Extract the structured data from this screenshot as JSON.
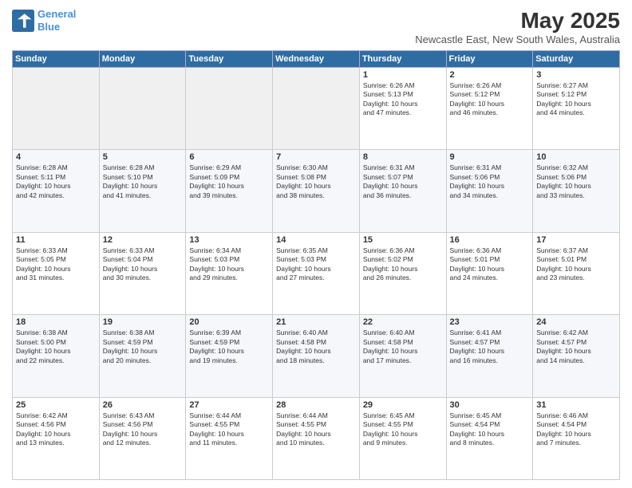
{
  "header": {
    "logo_line1": "General",
    "logo_line2": "Blue",
    "month": "May 2025",
    "location": "Newcastle East, New South Wales, Australia"
  },
  "weekdays": [
    "Sunday",
    "Monday",
    "Tuesday",
    "Wednesday",
    "Thursday",
    "Friday",
    "Saturday"
  ],
  "weeks": [
    [
      {
        "day": "",
        "info": ""
      },
      {
        "day": "",
        "info": ""
      },
      {
        "day": "",
        "info": ""
      },
      {
        "day": "",
        "info": ""
      },
      {
        "day": "1",
        "info": "Sunrise: 6:26 AM\nSunset: 5:13 PM\nDaylight: 10 hours\nand 47 minutes."
      },
      {
        "day": "2",
        "info": "Sunrise: 6:26 AM\nSunset: 5:12 PM\nDaylight: 10 hours\nand 46 minutes."
      },
      {
        "day": "3",
        "info": "Sunrise: 6:27 AM\nSunset: 5:12 PM\nDaylight: 10 hours\nand 44 minutes."
      }
    ],
    [
      {
        "day": "4",
        "info": "Sunrise: 6:28 AM\nSunset: 5:11 PM\nDaylight: 10 hours\nand 42 minutes."
      },
      {
        "day": "5",
        "info": "Sunrise: 6:28 AM\nSunset: 5:10 PM\nDaylight: 10 hours\nand 41 minutes."
      },
      {
        "day": "6",
        "info": "Sunrise: 6:29 AM\nSunset: 5:09 PM\nDaylight: 10 hours\nand 39 minutes."
      },
      {
        "day": "7",
        "info": "Sunrise: 6:30 AM\nSunset: 5:08 PM\nDaylight: 10 hours\nand 38 minutes."
      },
      {
        "day": "8",
        "info": "Sunrise: 6:31 AM\nSunset: 5:07 PM\nDaylight: 10 hours\nand 36 minutes."
      },
      {
        "day": "9",
        "info": "Sunrise: 6:31 AM\nSunset: 5:06 PM\nDaylight: 10 hours\nand 34 minutes."
      },
      {
        "day": "10",
        "info": "Sunrise: 6:32 AM\nSunset: 5:06 PM\nDaylight: 10 hours\nand 33 minutes."
      }
    ],
    [
      {
        "day": "11",
        "info": "Sunrise: 6:33 AM\nSunset: 5:05 PM\nDaylight: 10 hours\nand 31 minutes."
      },
      {
        "day": "12",
        "info": "Sunrise: 6:33 AM\nSunset: 5:04 PM\nDaylight: 10 hours\nand 30 minutes."
      },
      {
        "day": "13",
        "info": "Sunrise: 6:34 AM\nSunset: 5:03 PM\nDaylight: 10 hours\nand 29 minutes."
      },
      {
        "day": "14",
        "info": "Sunrise: 6:35 AM\nSunset: 5:03 PM\nDaylight: 10 hours\nand 27 minutes."
      },
      {
        "day": "15",
        "info": "Sunrise: 6:36 AM\nSunset: 5:02 PM\nDaylight: 10 hours\nand 26 minutes."
      },
      {
        "day": "16",
        "info": "Sunrise: 6:36 AM\nSunset: 5:01 PM\nDaylight: 10 hours\nand 24 minutes."
      },
      {
        "day": "17",
        "info": "Sunrise: 6:37 AM\nSunset: 5:01 PM\nDaylight: 10 hours\nand 23 minutes."
      }
    ],
    [
      {
        "day": "18",
        "info": "Sunrise: 6:38 AM\nSunset: 5:00 PM\nDaylight: 10 hours\nand 22 minutes."
      },
      {
        "day": "19",
        "info": "Sunrise: 6:38 AM\nSunset: 4:59 PM\nDaylight: 10 hours\nand 20 minutes."
      },
      {
        "day": "20",
        "info": "Sunrise: 6:39 AM\nSunset: 4:59 PM\nDaylight: 10 hours\nand 19 minutes."
      },
      {
        "day": "21",
        "info": "Sunrise: 6:40 AM\nSunset: 4:58 PM\nDaylight: 10 hours\nand 18 minutes."
      },
      {
        "day": "22",
        "info": "Sunrise: 6:40 AM\nSunset: 4:58 PM\nDaylight: 10 hours\nand 17 minutes."
      },
      {
        "day": "23",
        "info": "Sunrise: 6:41 AM\nSunset: 4:57 PM\nDaylight: 10 hours\nand 16 minutes."
      },
      {
        "day": "24",
        "info": "Sunrise: 6:42 AM\nSunset: 4:57 PM\nDaylight: 10 hours\nand 14 minutes."
      }
    ],
    [
      {
        "day": "25",
        "info": "Sunrise: 6:42 AM\nSunset: 4:56 PM\nDaylight: 10 hours\nand 13 minutes."
      },
      {
        "day": "26",
        "info": "Sunrise: 6:43 AM\nSunset: 4:56 PM\nDaylight: 10 hours\nand 12 minutes."
      },
      {
        "day": "27",
        "info": "Sunrise: 6:44 AM\nSunset: 4:55 PM\nDaylight: 10 hours\nand 11 minutes."
      },
      {
        "day": "28",
        "info": "Sunrise: 6:44 AM\nSunset: 4:55 PM\nDaylight: 10 hours\nand 10 minutes."
      },
      {
        "day": "29",
        "info": "Sunrise: 6:45 AM\nSunset: 4:55 PM\nDaylight: 10 hours\nand 9 minutes."
      },
      {
        "day": "30",
        "info": "Sunrise: 6:45 AM\nSunset: 4:54 PM\nDaylight: 10 hours\nand 8 minutes."
      },
      {
        "day": "31",
        "info": "Sunrise: 6:46 AM\nSunset: 4:54 PM\nDaylight: 10 hours\nand 7 minutes."
      }
    ]
  ]
}
